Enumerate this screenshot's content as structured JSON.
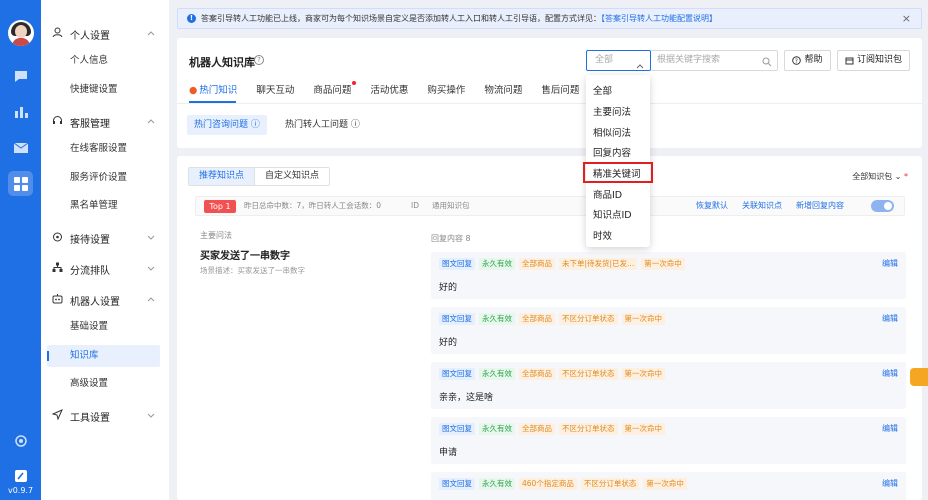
{
  "rail": {
    "version": "v0.9.7",
    "icons": [
      "chat-icon",
      "chart-icon",
      "mail-icon",
      "apps-icon",
      "settings-icon",
      "app-logo-icon"
    ]
  },
  "nav": {
    "groups": [
      {
        "label": "个人设置",
        "icon": "person-icon",
        "items": [
          "个人信息",
          "快捷键设置"
        ]
      },
      {
        "label": "客服管理",
        "icon": "headset-icon",
        "items": [
          "在线客服设置",
          "服务评价设置",
          "黑名单管理"
        ]
      },
      {
        "label": "接待设置",
        "icon": "flame-icon",
        "items": []
      },
      {
        "label": "分流排队",
        "icon": "network-icon",
        "items": []
      },
      {
        "label": "机器人设置",
        "icon": "robot-icon",
        "items": [
          "基础设置",
          "知识库",
          "高级设置"
        ]
      },
      {
        "label": "工具设置",
        "icon": "send-icon",
        "items": []
      }
    ],
    "active_item": "知识库"
  },
  "notice": {
    "text": "答案引导转人工功能已上线，商家可为每个知识场景自定义是否添加转人工入口和转人工引导语，配置方式详见：",
    "link": "【答案引导转人工功能配置说明】"
  },
  "header": {
    "title": "机器人知识库",
    "filter_selected": "全部",
    "search_placeholder": "根据关键字搜索",
    "help_label": "帮助",
    "subscribe_label": "订阅知识包"
  },
  "tabs": [
    "热门知识",
    "聊天互动",
    "商品问题",
    "活动优惠",
    "购买操作",
    "物流问题",
    "售后问题"
  ],
  "subtabs": [
    "热门咨询问题",
    "热门转人工问题"
  ],
  "segment": {
    "options": [
      "推荐知识点",
      "自定义知识点"
    ],
    "selected": "推荐知识点"
  },
  "all_kp_label": "全部知识包",
  "row": {
    "top_badge": "Top 1",
    "stats": "昨日总命中数：7，昨日转人工会话数：0",
    "id_label": "ID",
    "pack_label": "通用知识包",
    "actions": [
      "恢复默认",
      "关联知识点",
      "新增回复内容"
    ]
  },
  "question_label": "主要问法",
  "question": "买家发送了一串数字",
  "question_desc": "场景描述：买家发送了一串数字",
  "reply_header": "回复内容 8",
  "answers": [
    {
      "tags": [
        "图文回复",
        "永久有效",
        "全部商品",
        "未下单|待发货|已发...",
        "第一次命中"
      ],
      "body": "好的",
      "edit": "编辑"
    },
    {
      "tags": [
        "图文回复",
        "永久有效",
        "全部商品",
        "不区分订单状态",
        "第一次命中"
      ],
      "body": "好的",
      "edit": "编辑"
    },
    {
      "tags": [
        "图文回复",
        "永久有效",
        "全部商品",
        "不区分订单状态",
        "第一次命中"
      ],
      "body": "亲亲，这是啥",
      "edit": "编辑"
    },
    {
      "tags": [
        "图文回复",
        "永久有效",
        "全部商品",
        "不区分订单状态",
        "第一次命中"
      ],
      "body": "申请",
      "edit": "编辑"
    },
    {
      "tags": [
        "图文回复",
        "永久有效",
        "460个指定商品",
        "不区分订单状态",
        "第一次命中"
      ],
      "body": "",
      "edit": "编辑"
    }
  ],
  "dropdown": {
    "options": [
      "全部",
      "主要问法",
      "相似问法",
      "回复内容",
      "精准关键词",
      "商品ID",
      "知识点ID",
      "时效"
    ],
    "highlighted": "精准关键词"
  },
  "colors": {
    "primary": "#1f6fe5",
    "danger": "#f25151",
    "highlight_box": "#e02020"
  }
}
